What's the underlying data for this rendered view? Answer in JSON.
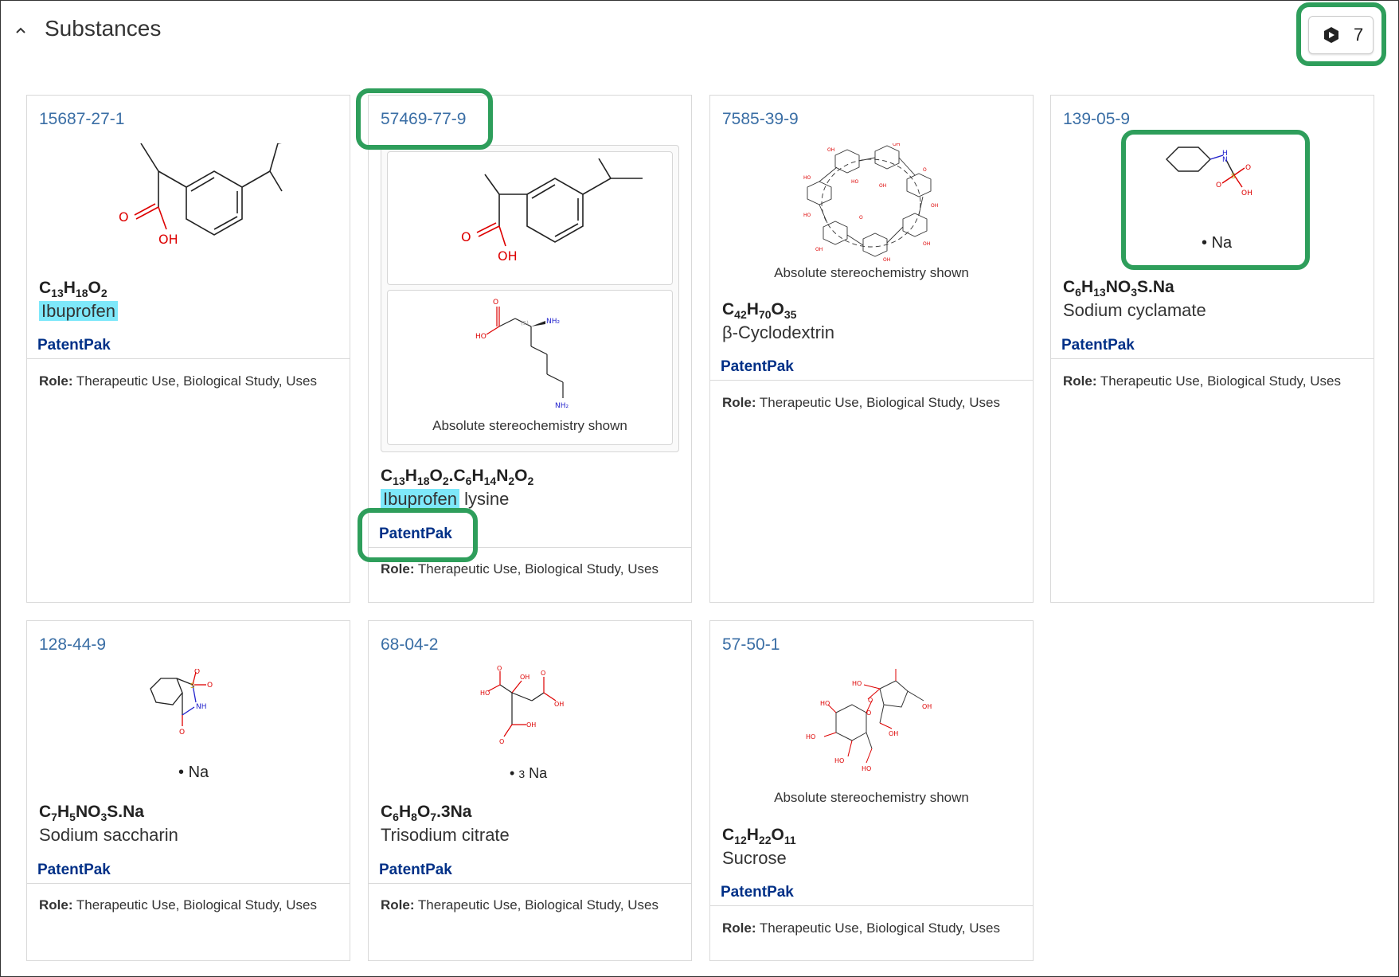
{
  "header": {
    "title": "Substances",
    "count": "7"
  },
  "common": {
    "patentpak": "PatentPak",
    "role_label": "Role:",
    "role_value": "Therapeutic Use, Biological Study, Uses",
    "stereo": "Absolute stereochemistry shown",
    "salt_na": "Na",
    "salt_3": "3"
  },
  "cards": [
    {
      "cas": "15687-27-1",
      "name": "Ibuprofen"
    },
    {
      "cas": "57469-77-9",
      "name_highlight": "Ibuprofen",
      "name_rest": " lysine"
    },
    {
      "cas": "7585-39-9",
      "name": "β-Cyclodextrin"
    },
    {
      "cas": "139-05-9",
      "name": "Sodium cyclamate"
    },
    {
      "cas": "128-44-9",
      "name": "Sodium saccharin"
    },
    {
      "cas": "68-04-2",
      "name": "Trisodium citrate"
    },
    {
      "cas": "57-50-1",
      "name": "Sucrose"
    }
  ],
  "colors": {
    "link": "#3a6ea5",
    "patentpak": "#003087",
    "highlight": "#7ee8fa",
    "callout": "#2e9e5b"
  }
}
